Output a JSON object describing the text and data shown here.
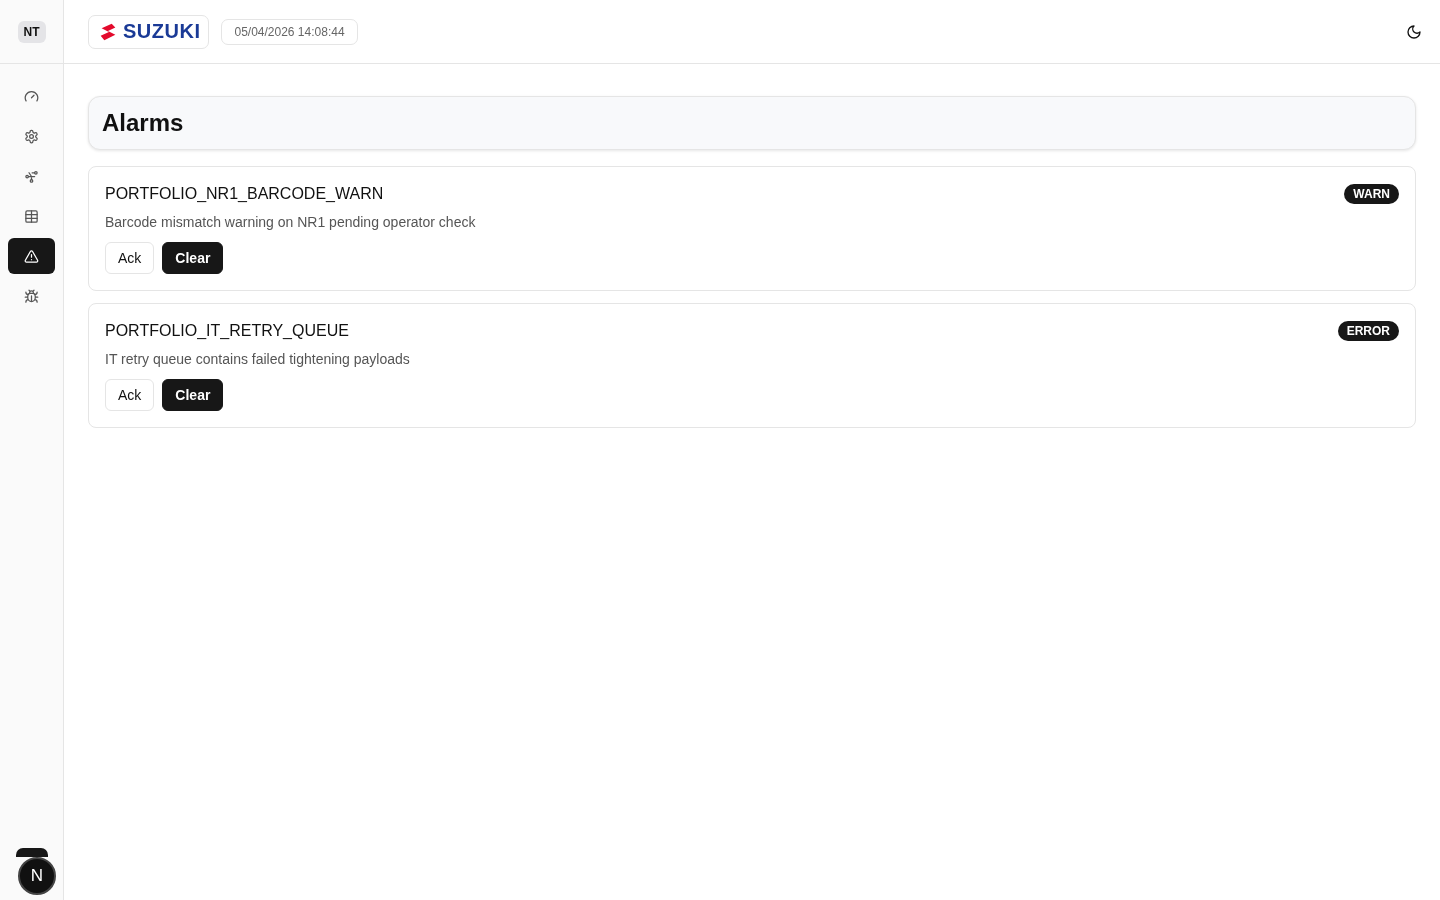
{
  "sidebar": {
    "badge": "NT",
    "items": [
      {
        "kind": "gauge",
        "selected": false
      },
      {
        "kind": "gear",
        "selected": false
      },
      {
        "kind": "network",
        "selected": false
      },
      {
        "kind": "table",
        "selected": false
      },
      {
        "kind": "warning",
        "selected": true
      },
      {
        "kind": "bug",
        "selected": false
      }
    ]
  },
  "header": {
    "logo": "SUZUKI",
    "datetime": "05/04/2026 14:08:44"
  },
  "page": {
    "title": "Alarms"
  },
  "alarms": [
    {
      "code": "PORTFOLIO_NR1_BARCODE_WARN",
      "message": "Barcode mismatch warning on NR1 pending operator check",
      "severity": "WARN",
      "actions": [
        "Ack",
        "Clear"
      ]
    },
    {
      "code": "PORTFOLIO_IT_RETRY_QUEUE",
      "message": "IT retry queue contains failed tightening payloads",
      "severity": "ERROR",
      "actions": [
        "Ack",
        "Clear"
      ]
    }
  ],
  "dev_indicator": {
    "letter": "N"
  }
}
